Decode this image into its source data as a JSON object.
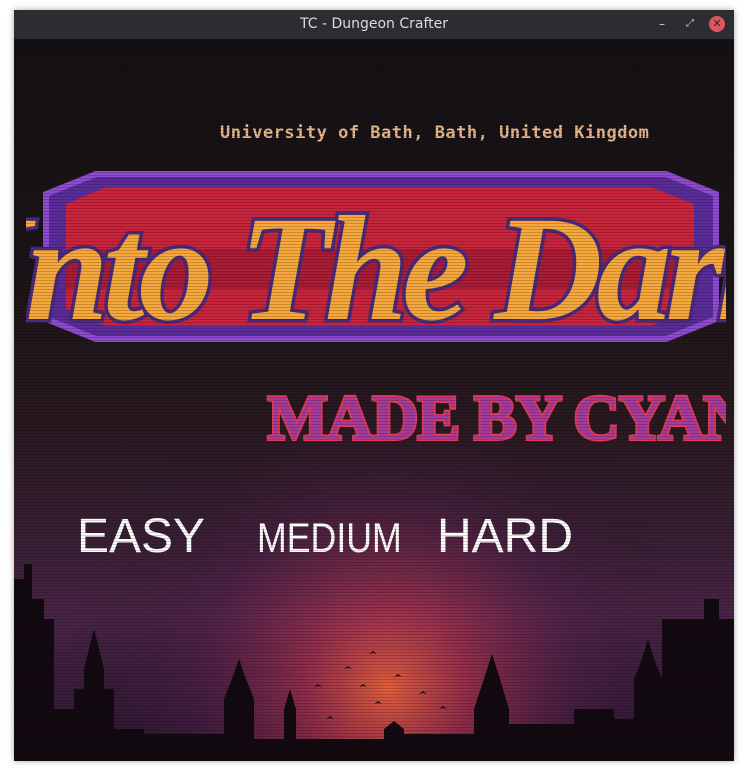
{
  "window": {
    "title": "TC - Dungeon Crafter",
    "minimize_icon": "minimize-icon",
    "maximize_icon": "maximize-icon",
    "close_icon": "close-icon",
    "close_color": "#e0555b"
  },
  "game": {
    "subtitle_top": "University of Bath, Bath, United Kingdom",
    "logo_title": "Into The Dark",
    "logo_credit": "MADE BY CYAN",
    "difficulty": {
      "easy": "EASY",
      "medium": "MEDIUM",
      "hard": "HARD"
    },
    "colors": {
      "logo_fill": "#f6a83c",
      "logo_outline": "#7a3aa8",
      "banner": "#c8243c",
      "credit_fill": "#a43a9c",
      "sun": "#ff7a3a"
    }
  }
}
